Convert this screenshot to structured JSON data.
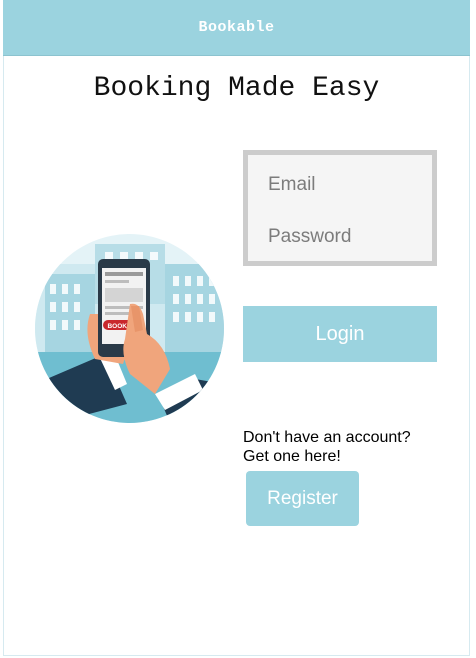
{
  "header": {
    "brand": "Bookable"
  },
  "hero": {
    "headline": "Booking Made Easy",
    "illustration": "hand-holding-phone-booking-illustration",
    "phone_badge": "BOOKING"
  },
  "form": {
    "email_placeholder": "Email",
    "password_placeholder": "Password",
    "login_label": "Login"
  },
  "signup": {
    "line1": "Don't have an account?",
    "line2": "Get one here!",
    "register_label": "Register"
  },
  "colors": {
    "accent": "#9bd3df",
    "box_border": "#cccccc",
    "box_bg": "#f5f5f5"
  }
}
